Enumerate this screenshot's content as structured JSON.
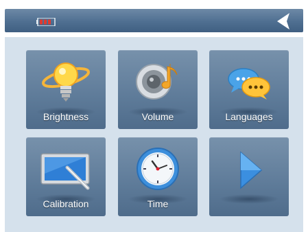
{
  "topbar": {
    "battery_icon": "battery-low-icon",
    "back_icon": "back-chevron-icon"
  },
  "tiles": [
    {
      "label": "Brightness",
      "icon": "lightbulb-icon"
    },
    {
      "label": "Volume",
      "icon": "speaker-icon"
    },
    {
      "label": "Languages",
      "icon": "chat-bubbles-icon"
    },
    {
      "label": "Calibration",
      "icon": "touchscreen-stylus-icon"
    },
    {
      "label": "Time",
      "icon": "clock-icon"
    },
    {
      "label": "",
      "icon": "next-arrow-icon"
    }
  ],
  "colors": {
    "topbar": "#4f6f91",
    "panel": "#d5e1ec",
    "tile": "#5e7b99",
    "battery_red": "#e03a2f"
  }
}
